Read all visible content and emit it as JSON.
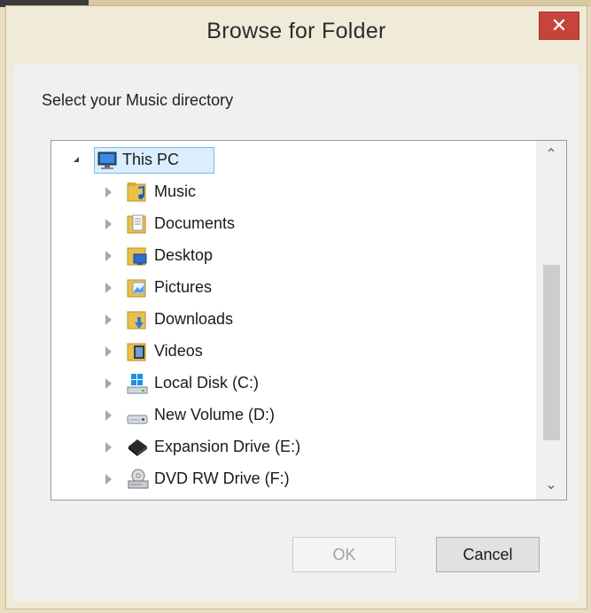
{
  "dialog": {
    "title": "Browse for Folder",
    "close_glyph": "✕",
    "prompt": "Select your Music directory"
  },
  "tree": {
    "root": {
      "label": "This PC",
      "icon": "this-pc-icon",
      "expanded": true,
      "selected": true
    },
    "items": [
      {
        "label": "Music",
        "icon": "music-folder-icon"
      },
      {
        "label": "Documents",
        "icon": "documents-folder-icon"
      },
      {
        "label": "Desktop",
        "icon": "desktop-folder-icon"
      },
      {
        "label": "Pictures",
        "icon": "pictures-folder-icon"
      },
      {
        "label": "Downloads",
        "icon": "downloads-folder-icon"
      },
      {
        "label": "Videos",
        "icon": "videos-folder-icon"
      },
      {
        "label": "Local Disk (C:)",
        "icon": "system-drive-icon"
      },
      {
        "label": "New Volume (D:)",
        "icon": "hard-drive-icon"
      },
      {
        "label": "Expansion Drive (E:)",
        "icon": "external-drive-icon"
      },
      {
        "label": "DVD RW Drive (F:)",
        "icon": "dvd-drive-icon"
      }
    ],
    "scroll_up_glyph": "⌃",
    "scroll_down_glyph": "⌄"
  },
  "buttons": {
    "ok": "OK",
    "cancel": "Cancel"
  },
  "colors": {
    "close_button": "#c7443c",
    "selection_fill": "#dbeeff",
    "selection_border": "#7dbbf0"
  }
}
